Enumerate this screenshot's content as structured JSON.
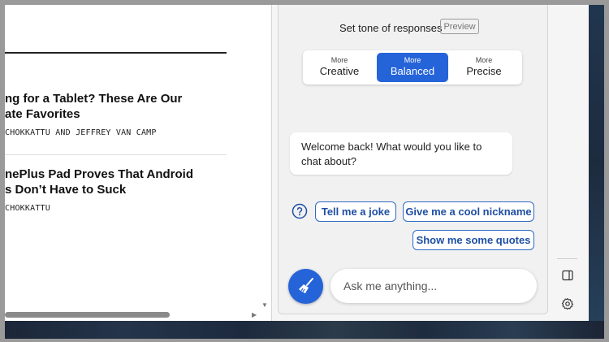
{
  "webpage": {
    "articles": [
      {
        "title": "ng for a Tablet? These Are Our\nate Favorites",
        "author": "CHOKKATTU AND JEFFREY VAN CAMP"
      },
      {
        "title": "nePlus Pad Proves That Android\ns Don’t Have to Suck",
        "author": "CHOKKATTU"
      }
    ]
  },
  "chat": {
    "tone_label": "Set tone of responses",
    "preview_label": "Preview",
    "tones": [
      {
        "small": "More",
        "big": "Creative",
        "active": false
      },
      {
        "small": "More",
        "big": "Balanced",
        "active": true
      },
      {
        "small": "More",
        "big": "Precise",
        "active": false
      }
    ],
    "welcome_message": "Welcome back! What would you like to chat about?",
    "suggestions": [
      "Tell me a joke",
      "Give me a cool nickname",
      "Show me some quotes"
    ],
    "input_placeholder": "Ask me anything...",
    "accent_color": "#2563d9"
  },
  "icons": {
    "help": "question-circle-icon",
    "new_topic": "broom-icon",
    "side_panel": "sidebar-panel-icon",
    "settings": "gear-icon"
  }
}
